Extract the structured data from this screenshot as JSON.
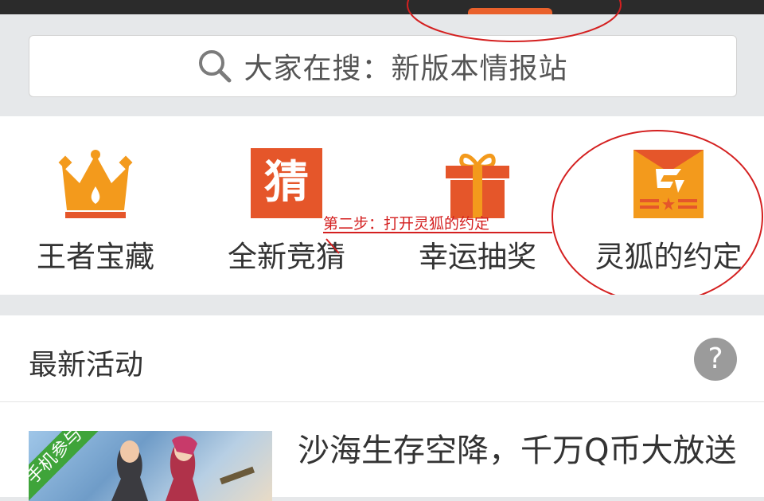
{
  "search": {
    "placeholder": "大家在搜：新版本情报站"
  },
  "features": [
    {
      "label": "王者宝藏",
      "icon": "crown-icon",
      "color": "#f39a1c"
    },
    {
      "label": "全新竞猜",
      "icon": "guess-icon",
      "icon_text": "猜",
      "color": "#e5562a"
    },
    {
      "label": "幸运抽奖",
      "icon": "gift-icon",
      "color": "#e5562a"
    },
    {
      "label": "灵狐的约定",
      "icon": "cf-envelope-icon",
      "color": "#f39a1c"
    }
  ],
  "section": {
    "title": "最新活动",
    "help": "?"
  },
  "card": {
    "badge": "手机参与",
    "headline": "沙海生存空降，千万Q币大放送"
  },
  "annotation": {
    "text": "第二步：打开灵狐的约定",
    "color": "#d42020"
  }
}
